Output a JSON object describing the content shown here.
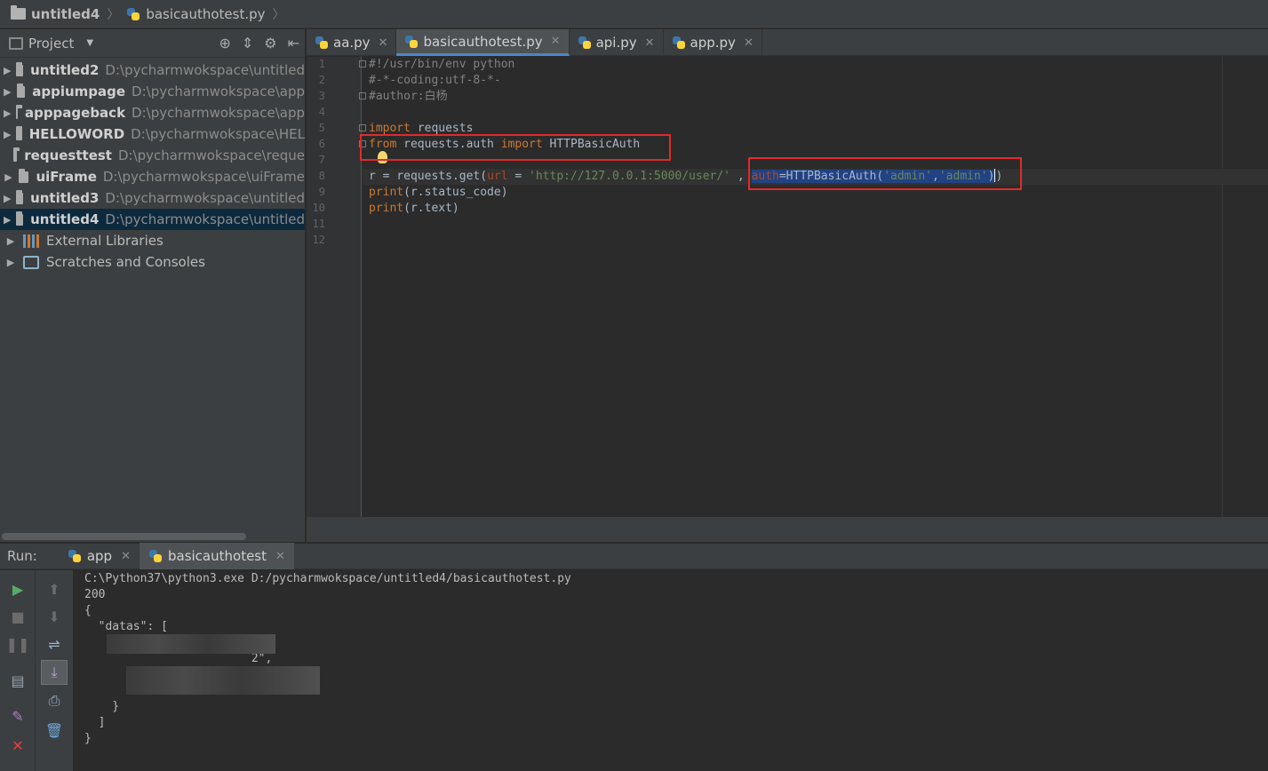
{
  "navbar": {
    "project": "untitled4",
    "file": "basicauthotest.py"
  },
  "project_panel": {
    "title": "Project",
    "items": [
      {
        "name": "untitled2",
        "path": "D:\\pycharmwokspace\\untitled"
      },
      {
        "name": "appiumpage",
        "path": "D:\\pycharmwokspace\\app"
      },
      {
        "name": "apppageback",
        "path": "D:\\pycharmwokspace\\app"
      },
      {
        "name": "HELLOWORD",
        "path": "D:\\pycharmwokspace\\HEL"
      },
      {
        "name": "requesttest",
        "path": "D:\\pycharmwokspace\\reque"
      },
      {
        "name": "uiFrame",
        "path": "D:\\pycharmwokspace\\uiFrame"
      },
      {
        "name": "untitled3",
        "path": "D:\\pycharmwokspace\\untitled"
      },
      {
        "name": "untitled4",
        "path": "D:\\pycharmwokspace\\untitled"
      }
    ],
    "external_libraries": "External Libraries",
    "scratches": "Scratches and Consoles"
  },
  "editor": {
    "tabs": [
      "aa.py",
      "basicauthotest.py",
      "api.py",
      "app.py"
    ],
    "active_tab": "basicauthotest.py",
    "line_numbers": [
      "1",
      "2",
      "3",
      "4",
      "5",
      "6",
      "7",
      "8",
      "9",
      "10",
      "11",
      "12"
    ],
    "code": {
      "l1": "#!/usr/bin/env python",
      "l2": "#-*-coding:utf-8-*-",
      "l3": "#author:白杨",
      "l5_kw": "import",
      "l5_rest": " requests",
      "l6_kw1": "from",
      "l6_mid": " requests.auth ",
      "l6_kw2": "import",
      "l6_rest": " HTTPBasicAuth",
      "l8_a": "r = requests.get(",
      "l8_p": "url",
      "l8_b": " = ",
      "l8_s": "'http://127.0.0.1:5000/user/'",
      "l8_c": " , ",
      "l8_p2": "auth",
      "l8_d": "=HTTPBasicAuth(",
      "l8_s2": "'admin'",
      "l8_e": ",",
      "l8_s3": "'admin'",
      "l8_f": ")",
      "l8_g": ")",
      "l9_kw": "print",
      "l9_rest": "(r.status_code)",
      "l10_kw": "print",
      "l10_rest": "(r.text)"
    }
  },
  "run_panel": {
    "label": "Run:",
    "tabs": [
      "app",
      "basicauthotest"
    ],
    "console": [
      "C:\\Python37\\python3.exe D:/pycharmwokspace/untitled4/basicauthotest.py",
      "200",
      "{",
      "  \"datas\": [",
      "    {",
      "                        2\",",
      "      \"u",
      "                        \\u56",
      "    }",
      "  ]",
      "}"
    ]
  },
  "colors": {
    "keyword": "#cc7832",
    "string": "#6a8759",
    "comment": "#808080",
    "highlight_box": "#e02b2b",
    "selection": "#214283"
  }
}
